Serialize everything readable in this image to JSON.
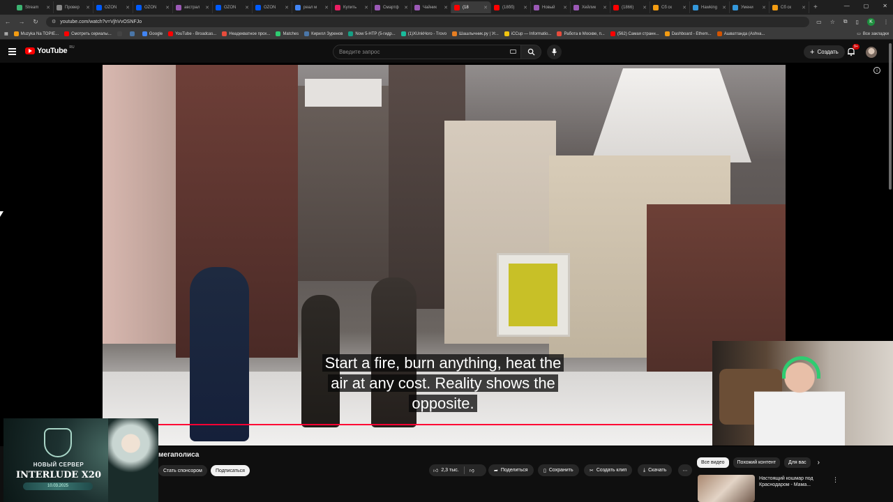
{
  "browser": {
    "tabs": [
      {
        "label": "Stream",
        "color": "#3cb371"
      },
      {
        "label": "Провер",
        "color": "#888888"
      },
      {
        "label": "OZON",
        "color": "#005bff"
      },
      {
        "label": "OZON",
        "color": "#005bff"
      },
      {
        "label": "австрал",
        "color": "#9b59b6"
      },
      {
        "label": "OZON",
        "color": "#005bff"
      },
      {
        "label": "OZON",
        "color": "#005bff"
      },
      {
        "label": "реал м",
        "color": "#4285f4"
      },
      {
        "label": "Купить",
        "color": "#e91e63"
      },
      {
        "label": "Смартф",
        "color": "#9b59b6"
      },
      {
        "label": "Чайник",
        "color": "#9b59b6"
      },
      {
        "label": "(18",
        "color": "#ff0000"
      },
      {
        "label": "(18бб)",
        "color": "#ff0000"
      },
      {
        "label": "Новый",
        "color": "#9b59b6"
      },
      {
        "label": "Хейлик",
        "color": "#9b59b6"
      },
      {
        "label": "(1866)",
        "color": "#ff0000"
      },
      {
        "label": "Сб ск",
        "color": "#f39c12"
      },
      {
        "label": "Hawking",
        "color": "#3498db"
      },
      {
        "label": "Умени",
        "color": "#3498db"
      },
      {
        "label": "Сб ск",
        "color": "#f39c12"
      }
    ],
    "url": "youtube.com/watch?v=VjhVvOSNFJo",
    "profile_letter": "K",
    "bookmarks": [
      {
        "label": "Muzyka Na TOPIE...",
        "color": "#f39c12"
      },
      {
        "label": "Смотреть сериалы...",
        "color": "#ff0000"
      },
      {
        "label": "",
        "color": "#444444"
      },
      {
        "label": "",
        "color": "#4a76a8"
      },
      {
        "label": "Google",
        "color": "#4285f4"
      },
      {
        "label": "YouTube - Broadcas...",
        "color": "#ff0000"
      },
      {
        "label": "Неадекватное прох...",
        "color": "#e74c3c"
      },
      {
        "label": "Matches",
        "color": "#2ecc71"
      },
      {
        "label": "Кирилл Зуренов",
        "color": "#4a76a8"
      },
      {
        "label": "Now 5-HTP (5-гидр...",
        "color": "#16a085"
      },
      {
        "label": "(1)XUnkHoro - Trovo",
        "color": "#1abc9c"
      },
      {
        "label": "Шашлычник.ру | Уг...",
        "color": "#e67e22"
      },
      {
        "label": "iCCup — Informatio...",
        "color": "#f1c40f"
      },
      {
        "label": "Работа в Москве, п...",
        "color": "#e74c3c"
      },
      {
        "label": "(562) Самая странн...",
        "color": "#ff0000"
      },
      {
        "label": "Dashboard - Ethem...",
        "color": "#f39c12"
      },
      {
        "label": "Ашватганда (Ashva...",
        "color": "#d35400"
      }
    ],
    "bookmarks_all": "Все закладки"
  },
  "youtube": {
    "logo_text": "YouTube",
    "logo_region": "RU",
    "search_placeholder": "Введите запрос",
    "create_label": "Создать",
    "notif_badge": "9+"
  },
  "video": {
    "subtitle": "Start a fire, burn anything, heat the air at any cost. Reality shows the opposite.",
    "progress_fraction": 0.893,
    "title_fragment": "мегаполиса"
  },
  "ad": {
    "line1": "НОВЫЙ СЕРВЕР",
    "line2": "INTERLUDE X20",
    "line3": "10.03.2025"
  },
  "actions": {
    "sponsor": "Стать спонсором",
    "subscribe": "Подписаться",
    "likes": "2,3 тыс.",
    "share": "Поделиться",
    "save": "Сохранить",
    "clip": "Создать клип",
    "download": "Скачать"
  },
  "chips": [
    "Все видео",
    "Похожий контент",
    "Для вас"
  ],
  "recommendation": {
    "title": "Настоящий кошмар под Краснодаром - Мама..."
  },
  "colors": {
    "accent": "#ff0033",
    "bg": "#0f0f0f"
  }
}
